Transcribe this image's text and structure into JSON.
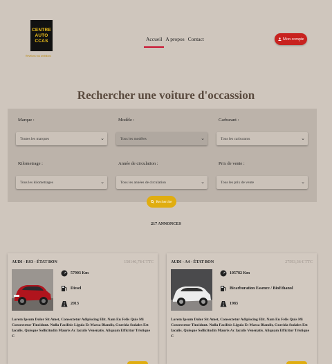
{
  "header": {
    "logo_lines": [
      "CENTRE",
      "AUTO",
      "CCAS"
    ],
    "logo_tagline": "Révélons vos ambitions",
    "nav": [
      {
        "label": "Accueil",
        "active": true
      },
      {
        "label": "A propos",
        "active": false
      },
      {
        "label": "Contact",
        "active": false
      }
    ],
    "account_label": "Mon compte",
    "account_icon": "user-icon"
  },
  "search": {
    "title": "Rechercher une voiture d'occassion",
    "filters": [
      {
        "label": "Marque :",
        "value": "Toutes les marques"
      },
      {
        "label": "Modèle :",
        "value": "Tous les modèles"
      },
      {
        "label": "Carburant :",
        "value": "Tous les carburants"
      },
      {
        "label": "Kilometrage :",
        "value": "Tous les kilometrages"
      },
      {
        "label": "Année de circulation :",
        "value": "Tous les années de circulation"
      },
      {
        "label": "Prix de vente :",
        "value": "Tous les prix de vente"
      }
    ],
    "button_label": "Recherche",
    "button_icon": "search-icon"
  },
  "results": {
    "count_label": "217 ANNONCES"
  },
  "cards": [
    {
      "title": "AUDI - RS3 - ÉTAT BON",
      "price": "150140,78 € TTC",
      "car_color": "#b0141d",
      "mileage": "57903 Km",
      "fuel": "Diesel",
      "year": "2013",
      "description": "Lorem Ipsum Dolor Sit Amet, Consectetur Adipiscing Elit. Nam Eu Felis Quis Mi Consectetur Tincidunt. Nulla Facilisis Ligula Et Massa Blandit, Gravida Sodales Est Iaculis. Quisque Sollicitudin Mauris Ac Iaculis Venenatis. Aliquam Efficitur Tristique C"
    },
    {
      "title": "AUDI - A4 - ÉTAT BON",
      "price": "27593,36 € TTC",
      "car_color": "#e8e8e8",
      "mileage": "105782 Km",
      "fuel": "Bicarburation Essence / BioEthanol",
      "year": "1983",
      "description": "Lorem Ipsum Dolor Sit Amet, Consectetur Adipiscing Elit. Nam Eu Felis Quis Mi Consectetur Tincidunt. Nulla Facilisis Ligula Et Massa Blandit, Gravida Sodales Est Iaculis. Quisque Sollicitudin Mauris Ac Iaculis Venenatis. Aliquam Efficitur Tristique C"
    }
  ],
  "colors": {
    "background": "#cfc6bd",
    "panel": "#bcb3aa",
    "accent_red": "#c8221f",
    "accent_yellow": "#e0ad10",
    "title": "#5a4a3e"
  }
}
